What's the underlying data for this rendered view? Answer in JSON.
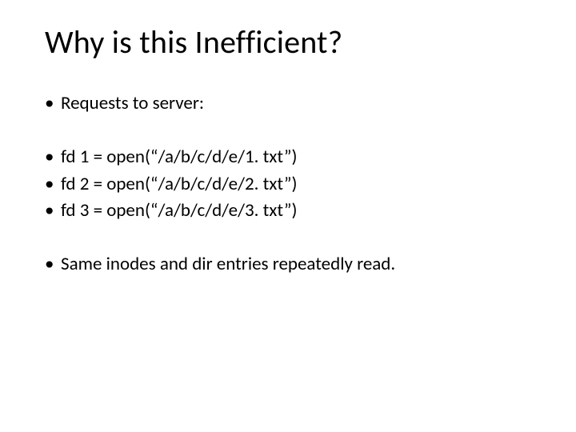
{
  "title": "Why is this Inefficient?",
  "bullet1": "Requests to server:",
  "bullet2": "fd 1 = open(“/a/b/c/d/e/1. txt”)",
  "bullet3": "fd 2 = open(“/a/b/c/d/e/2. txt”)",
  "bullet4": "fd 3 = open(“/a/b/c/d/e/3. txt”)",
  "bullet5": "Same inodes and dir entries repeatedly read."
}
